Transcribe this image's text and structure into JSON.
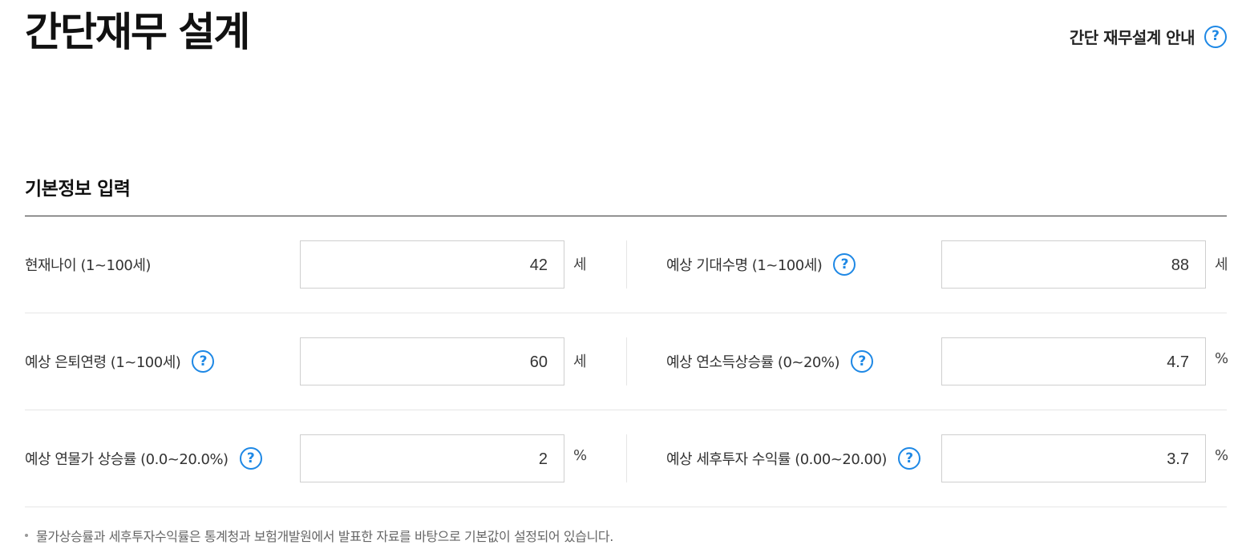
{
  "header": {
    "title": "간단재무 설계",
    "guide_label": "간단 재무설계 안내",
    "help_glyph": "?"
  },
  "section": {
    "title": "기본정보 입력"
  },
  "fields": {
    "current_age": {
      "label": "현재나이 (1~100세)",
      "value": "42",
      "unit": "세"
    },
    "life_expectancy": {
      "label": "예상 기대수명 (1~100세)",
      "value": "88",
      "unit": "세"
    },
    "retirement_age": {
      "label": "예상 은퇴연령 (1~100세)",
      "value": "60",
      "unit": "세"
    },
    "income_growth": {
      "label": "예상 연소득상승률 (0~20%)",
      "value": "4.7",
      "unit": "%"
    },
    "inflation": {
      "label": "예상 연물가 상승률 (0.0~20.0%)",
      "value": "2",
      "unit": "%"
    },
    "investment_return": {
      "label": "예상 세후투자 수익률 (0.00~20.00)",
      "value": "3.7",
      "unit": "%"
    }
  },
  "note": "물가상승률과 세후투자수익률은 통계청과 보험개발원에서 발표한 자료를 바탕으로 기본값이 설정되어 있습니다.",
  "icons": {
    "help": "question-circle-icon"
  },
  "colors": {
    "accent": "#1e88e5",
    "text": "#222222",
    "border": "#cfcfcf"
  }
}
